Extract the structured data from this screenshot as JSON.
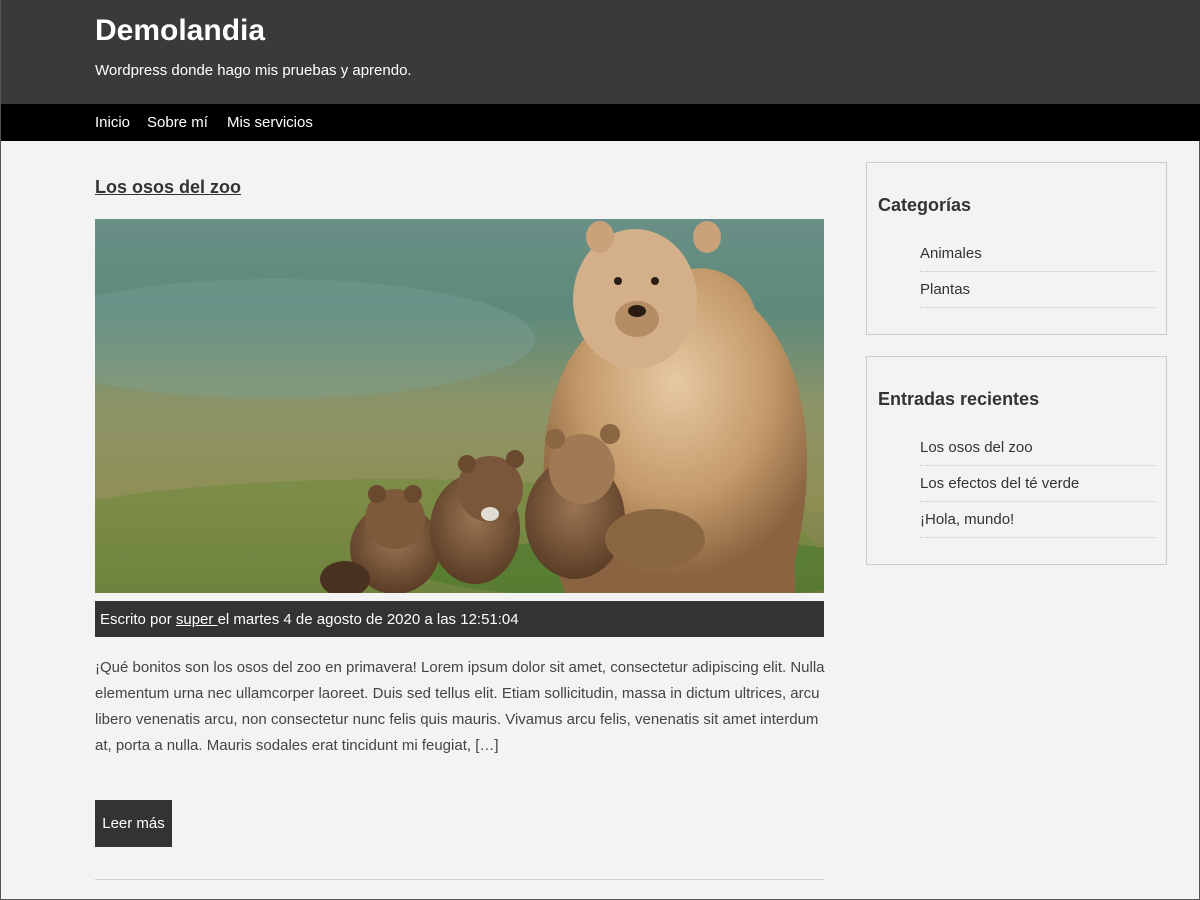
{
  "header": {
    "site_title": "Demolandia",
    "tagline": "Wordpress donde hago mis pruebas y aprendo."
  },
  "nav": {
    "items": [
      "Inicio",
      "Sobre mí",
      "Mis servicios"
    ]
  },
  "post": {
    "title": "Los osos del zoo",
    "image_icon": "photo-bears",
    "meta_prefix": "Escrito por ",
    "author": "super ",
    "meta_suffix": "el martes 4 de agosto de 2020 a las 12:51:04",
    "excerpt": "¡Qué bonitos son los osos del zoo en primavera! Lorem ipsum dolor sit amet, consectetur adipiscing elit. Nulla elementum urna nec ullamcorper laoreet. Duis sed tellus elit. Etiam sollicitudin, massa in dictum ultrices, arcu libero venenatis arcu, non consectetur nunc felis quis mauris. Vivamus arcu felis, venenatis sit amet interdum at, porta a nulla. Mauris sodales erat tincidunt mi feugiat, […]",
    "read_more": "Leer más"
  },
  "sidebar": {
    "categories": {
      "title": "Categorías",
      "items": [
        "Animales",
        "Plantas"
      ]
    },
    "recent": {
      "title": "Entradas recientes",
      "items": [
        "Los osos del zoo",
        "Los efectos del té verde",
        "¡Hola, mundo!"
      ]
    }
  },
  "colors": {
    "header_bg": "#3a3a3a",
    "nav_bg": "#000000",
    "page_bg": "#f3f3f3",
    "meta_bg": "#333333"
  }
}
